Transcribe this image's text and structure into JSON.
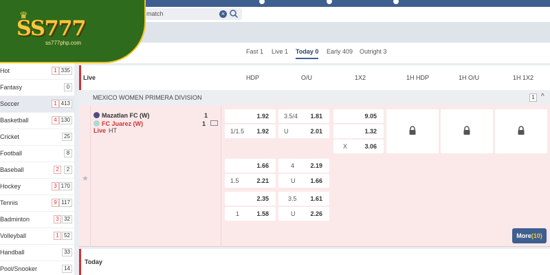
{
  "brand": {
    "logo_text": "SS777",
    "logo_url": "ss777php.com"
  },
  "search": {
    "placeholder": "match",
    "clear_symbol": "×"
  },
  "tabs": [
    {
      "label": "Fast 1",
      "active": false
    },
    {
      "label": "Live 1",
      "active": false
    },
    {
      "label": "Today 0",
      "active": true
    },
    {
      "label": "Early 409",
      "active": false
    },
    {
      "label": "Outright 3",
      "active": false
    }
  ],
  "sidebar": {
    "items": [
      {
        "label": "Hot",
        "live": "1",
        "count": "335",
        "selected": false
      },
      {
        "label": "Fantasy",
        "live": "",
        "count": "0",
        "selected": false
      },
      {
        "label": "Soccer",
        "live": "1",
        "count": "413",
        "selected": true
      },
      {
        "label": "Basketball",
        "live": "4",
        "count": "130",
        "selected": false
      },
      {
        "label": "Cricket",
        "live": "",
        "count": "25",
        "selected": false
      },
      {
        "label": "Football",
        "live": "",
        "count": "8",
        "selected": false
      },
      {
        "label": "Baseball",
        "live": "2",
        "count": "2",
        "selected": false
      },
      {
        "label": "Hockey",
        "live": "3",
        "count": "170",
        "selected": false
      },
      {
        "label": "Tennis",
        "live": "9",
        "count": "117",
        "selected": false
      },
      {
        "label": "Badminton",
        "live": "3",
        "count": "32",
        "selected": false
      },
      {
        "label": "Volleyball",
        "live": "1",
        "count": "52",
        "selected": false
      },
      {
        "label": "Handball",
        "live": "",
        "count": "33",
        "selected": false
      },
      {
        "label": "Pool/Snooker",
        "live": "",
        "count": "14",
        "selected": false
      }
    ]
  },
  "header": {
    "section": "Live",
    "columns": [
      "HDP",
      "O/U",
      "1X2",
      "1H HDP",
      "1H O/U",
      "1H 1X2"
    ]
  },
  "league": {
    "name": "MEXICO WOMEN PRIMERA DIVISION",
    "count": "1",
    "chevron": "^"
  },
  "match": {
    "home": {
      "name": "Mazatlan FC (W)",
      "score": "1"
    },
    "away": {
      "name": "FC Juarez (W)",
      "score": "1"
    },
    "status_live": "Live",
    "status_time": "HT"
  },
  "odds_rows": [
    {
      "hdp": [
        {
          "hc": "",
          "odds": "1.92"
        },
        {
          "hc": "1/1.5",
          "odds": "1.92"
        }
      ],
      "ou": [
        {
          "hc": "3.5/4",
          "odds": "1.81"
        },
        {
          "hc": "U",
          "odds": "2.01"
        }
      ],
      "x12": [
        {
          "hc": "",
          "odds": "9.05"
        },
        {
          "hc": "",
          "odds": "1.32"
        },
        {
          "hc": "X",
          "odds": "3.06"
        }
      ]
    },
    {
      "hdp": [
        {
          "hc": "",
          "odds": "1.66"
        },
        {
          "hc": "1.5",
          "odds": "2.21"
        }
      ],
      "ou": [
        {
          "hc": "4",
          "odds": "2.19"
        },
        {
          "hc": "U",
          "odds": "1.66"
        }
      ]
    },
    {
      "hdp": [
        {
          "hc": "",
          "odds": "2.35"
        },
        {
          "hc": "1",
          "odds": "1.58"
        }
      ],
      "ou": [
        {
          "hc": "3.5",
          "odds": "1.61"
        },
        {
          "hc": "U",
          "odds": "2.26"
        }
      ]
    }
  ],
  "more": {
    "label": "More",
    "count": "(10)"
  },
  "today_section": "Today",
  "colors": {
    "primary": "#3e5f8f",
    "live_red": "#cc3333",
    "logo_green": "#2e6b1c",
    "logo_gold": "#f5c842"
  }
}
